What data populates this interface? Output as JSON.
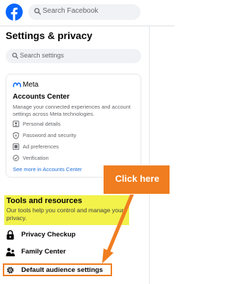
{
  "topbar": {
    "logo_icon": "facebook-logo-icon",
    "search_placeholder": "Search Facebook"
  },
  "page": {
    "title": "Settings & privacy",
    "search_placeholder": "Search settings"
  },
  "accounts_center": {
    "brand": "Meta",
    "title": "Accounts Center",
    "description": "Manage your connected experiences and account settings across Meta technologies.",
    "items": [
      {
        "icon": "person-icon",
        "label": "Personal details"
      },
      {
        "icon": "shield-icon",
        "label": "Password and security"
      },
      {
        "icon": "ad-icon",
        "label": "Ad preferences"
      },
      {
        "icon": "verification-icon",
        "label": "Verification"
      }
    ],
    "link": "See more in Accounts Center"
  },
  "tools": {
    "title": "Tools and resources",
    "description": "Our tools help you control and manage your privacy.",
    "items": [
      {
        "icon": "lock-icon",
        "label": "Privacy Checkup"
      },
      {
        "icon": "family-icon",
        "label": "Family Center"
      },
      {
        "icon": "gear-icon",
        "label": "Default audience settings"
      }
    ]
  },
  "annotation": {
    "callout": "Click here",
    "color": "#f07d1f",
    "highlight_color": "#f2f24a"
  },
  "colors": {
    "facebook_blue": "#0866ff",
    "link_blue": "#216fdb",
    "secondary_text": "#65676b"
  }
}
